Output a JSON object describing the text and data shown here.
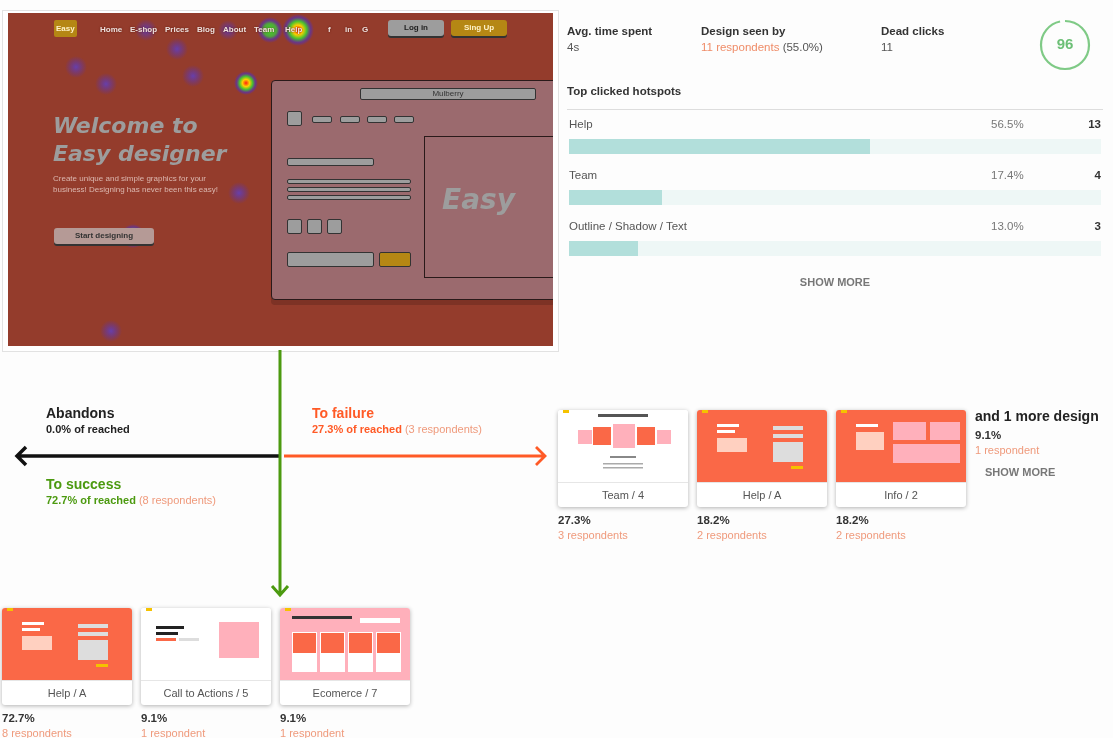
{
  "heatmap": {
    "logo": "Easy",
    "nav": [
      "Home",
      "E-shop",
      "Prices",
      "Blog",
      "About",
      "Team",
      "Help"
    ],
    "social": [
      "f",
      "in",
      "G"
    ],
    "login": "Log in",
    "signup": "Sing Up",
    "address": "Mulberry",
    "headline": [
      "Welcome to",
      "Easy designer"
    ],
    "tagline": "Create unique and simple graphics for your business! Designing has never been this easy!",
    "cta": "Start designing",
    "preview_word": "Easy"
  },
  "stats": [
    {
      "label": "Avg. time spent",
      "value": "4s"
    },
    {
      "label": "Design seen by",
      "value": "11 respondents",
      "extra": "(55.0%)"
    },
    {
      "label": "Dead clicks",
      "value": "11"
    }
  ],
  "score": {
    "value": "96",
    "level": 0.96
  },
  "hotspots": {
    "title": "Top clicked hotspots",
    "show_more": "SHOW MORE",
    "items": [
      {
        "label": "Help",
        "percent": "56.5%",
        "count": "13",
        "level": 0.565
      },
      {
        "label": "Team",
        "percent": "17.4%",
        "count": "4",
        "level": 0.174
      },
      {
        "label": "Outline / Shadow / Text",
        "percent": "13.0%",
        "count": "3",
        "level": 0.13
      }
    ]
  },
  "flow": {
    "abandons": {
      "title": "Abandons",
      "rate": "0.0% of reached"
    },
    "failure": {
      "title": "To failure",
      "rate": "27.3% of reached",
      "respondents": "(3 respondents)"
    },
    "success": {
      "title": "To success",
      "rate": "72.7% of reached",
      "respondents": "(8 respondents)"
    }
  },
  "failure_designs": [
    {
      "name": "Team / 4",
      "percent": "27.3%",
      "respondents": "3 respondents",
      "kind": "team"
    },
    {
      "name": "Help / A",
      "percent": "18.2%",
      "respondents": "2 respondents",
      "kind": "help"
    },
    {
      "name": "Info / 2",
      "percent": "18.2%",
      "respondents": "2 respondents",
      "kind": "info"
    }
  ],
  "more": {
    "title": "and 1 more design",
    "percent": "9.1%",
    "respondents": "1 respondent",
    "show_more": "SHOW MORE"
  },
  "success_designs": [
    {
      "name": "Help / A",
      "percent": "72.7%",
      "respondents": "8 respondents",
      "kind": "help"
    },
    {
      "name": "Call to Actions / 5",
      "percent": "9.1%",
      "respondents": "1 respondent",
      "kind": "cta"
    },
    {
      "name": "Ecomerce / 7",
      "percent": "9.1%",
      "respondents": "1 respondent",
      "kind": "ecommerce"
    }
  ]
}
